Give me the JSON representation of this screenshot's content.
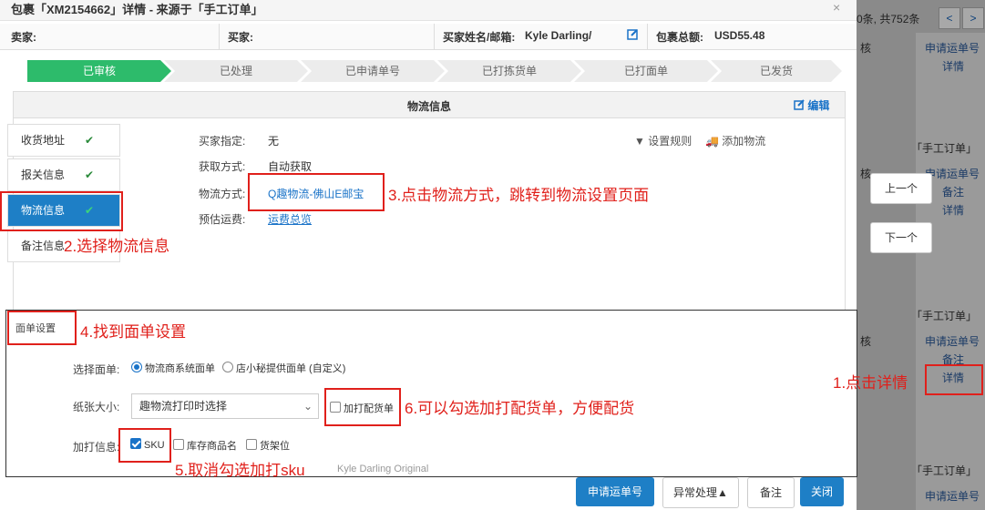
{
  "modal": {
    "title": "包裹「XM2154662」详情 - 来源于「手工订单」",
    "close": "×",
    "seller_label": "卖家:",
    "buyer_label": "买家:",
    "buyer_name_label": "买家姓名/邮箱:",
    "buyer_name_value": "Kyle Darling/",
    "package_total_label": "包裹总额:",
    "package_total_value": "USD55.48"
  },
  "steps": [
    "已审核",
    "已处理",
    "已申请单号",
    "已打拣货单",
    "已打面单",
    "已发货"
  ],
  "panel": {
    "title": "物流信息",
    "edit_label": "编辑",
    "tabs": [
      {
        "label": "收货地址",
        "check": "✔"
      },
      {
        "label": "报关信息",
        "check": "✔"
      },
      {
        "label": "物流信息",
        "check": "✔"
      },
      {
        "label": "备注信息",
        "check": ""
      }
    ],
    "fields": {
      "buyer_specified_label": "买家指定:",
      "buyer_specified_value": "无",
      "fetch_method_label": "获取方式:",
      "fetch_method_value": "自动获取",
      "shipping_method_label": "物流方式:",
      "shipping_method_value": "Q趣物流-佛山E邮宝",
      "estimated_fee_label": "预估运费:",
      "estimated_fee_value": "运费总览"
    },
    "set_rule": "设置规则",
    "add_logistics": "添加物流"
  },
  "face_sheet": {
    "tab_label": "面单设置",
    "select_face_label": "选择面单:",
    "option_system": "物流商系统面单",
    "option_custom": "店小秘提供面单 (自定义)",
    "paper_size_label": "纸张大小:",
    "paper_size_value": "趣物流打印时选择",
    "print_pick_list": "加打配货单",
    "extra_print_label": "加打信息:",
    "extra_sku": "SKU",
    "extra_stock_name": "库存商品名",
    "extra_shelf": "货架位",
    "obscured_text": "Kyle Darling Original"
  },
  "footer": {
    "apply_tracking": "申请运单号",
    "exception": "异常处理▲",
    "note": "备注",
    "close": "关闭"
  },
  "background": {
    "pagination_text": "0条, 共752条",
    "prev": "<",
    "next": ">",
    "audit_1": "核",
    "audit_2": "核",
    "audit_3": "核",
    "apply_tracking_1": "申请运单号",
    "detail_1": "详情",
    "manual_order_1": "「手工订单」",
    "apply_tracking_2": "申请运单号",
    "note_2": "备注",
    "detail_2": "详情",
    "manual_order_2": "「手工订单」",
    "apply_tracking_3": "申请运单号",
    "note_3": "备注",
    "detail_3": "详情",
    "manual_order_3": "「手工订单」",
    "apply_tracking_4": "申请运单号",
    "prev_item": "上一个",
    "next_item": "下一个"
  },
  "annotations": {
    "a1": "1.点击详情",
    "a2": "2.选择物流信息",
    "a3": "3.点击物流方式，跳转到物流设置页面",
    "a4": "4.找到面单设置",
    "a5": "5.取消勾选加打sku",
    "a6": "6.可以勾选加打配货单，方便配货"
  }
}
